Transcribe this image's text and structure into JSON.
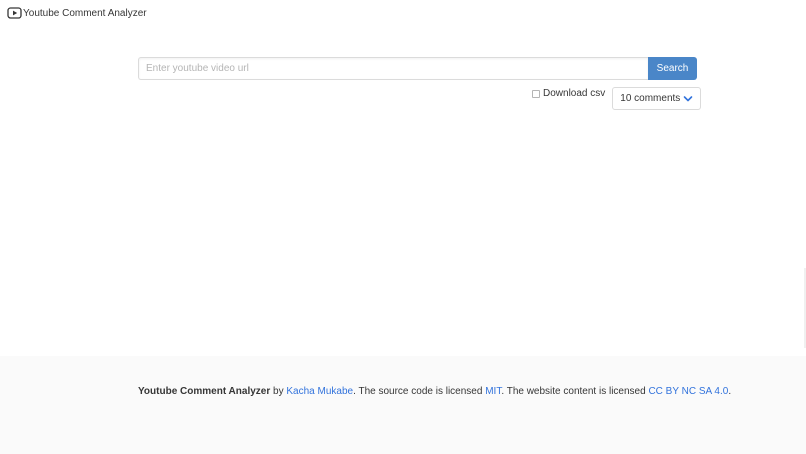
{
  "header": {
    "brand_icon": "youtube-play-icon",
    "brand_title": "Youtube Comment Analyzer"
  },
  "search": {
    "placeholder": "Enter youtube video url",
    "value": "",
    "button_label": "Search"
  },
  "options": {
    "download_csv_label": "Download csv",
    "download_csv_checked": false,
    "comments_select": {
      "selected": "10 comments",
      "icon": "chevron-down-icon"
    }
  },
  "footer": {
    "app_name": "Youtube Comment Analyzer",
    "by_text": "by",
    "author_link": "Kacha Mukabe",
    "code_license_text": ". The source code is licensed",
    "code_license_link": "MIT",
    "content_license_text": ". The website content is licensed",
    "content_license_link": "CC BY NC SA 4.0",
    "end_text": "."
  },
  "colors": {
    "primary": "#4a86c8",
    "link": "#3273dc",
    "text": "#363636",
    "footer_bg": "#fafafa",
    "border": "#dbdbdb"
  }
}
